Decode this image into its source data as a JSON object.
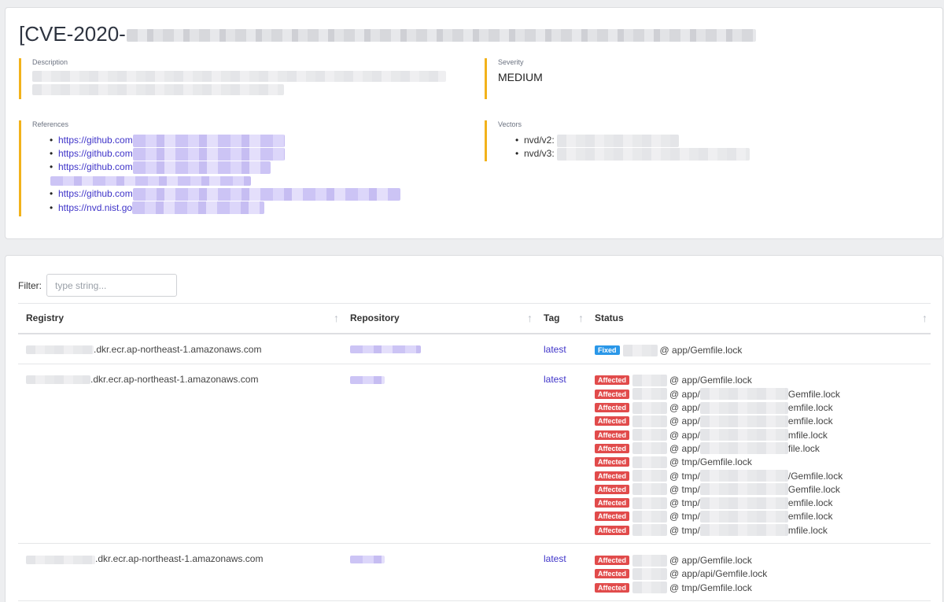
{
  "cve": {
    "title_prefix": "[CVE-2020-"
  },
  "description": {
    "label": "Description"
  },
  "severity": {
    "label": "Severity",
    "value": "MEDIUM"
  },
  "references": {
    "label": "References",
    "items": [
      "https://github.com",
      "https://github.com",
      "https://github.com",
      "https://github.com",
      "https://nvd.nist.go"
    ]
  },
  "vectors": {
    "label": "Vectors",
    "items": [
      "nvd/v2:",
      "nvd/v3:"
    ]
  },
  "filter": {
    "label": "Filter:",
    "placeholder": "type string..."
  },
  "table": {
    "columns": [
      "Registry",
      "Repository",
      "Tag",
      "Status"
    ],
    "sort_icon": "arrow-up-icon",
    "rows": [
      {
        "registry": ".dkr.ecr.ap-northeast-1.amazonaws.com",
        "tag": "latest",
        "statuses": [
          {
            "badge": "Fixed",
            "kind": "fixed",
            "text": "@ app/Gemfile.lock"
          }
        ]
      },
      {
        "registry": ".dkr.ecr.ap-northeast-1.amazonaws.com",
        "tag": "latest",
        "statuses": [
          {
            "badge": "Affected",
            "kind": "affected",
            "text": "@ app/Gemfile.lock"
          },
          {
            "badge": "Affected",
            "kind": "affected",
            "text": "@ app/",
            "tail": "Gemfile.lock"
          },
          {
            "badge": "Affected",
            "kind": "affected",
            "text": "@ app/",
            "tail": "emfile.lock"
          },
          {
            "badge": "Affected",
            "kind": "affected",
            "text": "@ app/",
            "tail": "emfile.lock"
          },
          {
            "badge": "Affected",
            "kind": "affected",
            "text": "@ app/",
            "tail": "mfile.lock"
          },
          {
            "badge": "Affected",
            "kind": "affected",
            "text": "@ app/",
            "tail": "file.lock"
          },
          {
            "badge": "Affected",
            "kind": "affected",
            "text": "@ tmp/Gemfile.lock"
          },
          {
            "badge": "Affected",
            "kind": "affected",
            "text": "@ tmp/",
            "tail": "/Gemfile.lock"
          },
          {
            "badge": "Affected",
            "kind": "affected",
            "text": "@ tmp/",
            "tail": "Gemfile.lock"
          },
          {
            "badge": "Affected",
            "kind": "affected",
            "text": "@ tmp/",
            "tail": "emfile.lock"
          },
          {
            "badge": "Affected",
            "kind": "affected",
            "text": "@ tmp/",
            "tail": "emfile.lock"
          },
          {
            "badge": "Affected",
            "kind": "affected",
            "text": "@ tmp/",
            "tail": "mfile.lock"
          }
        ]
      },
      {
        "registry": ".dkr.ecr.ap-northeast-1.amazonaws.com",
        "tag": "latest",
        "statuses": [
          {
            "badge": "Affected",
            "kind": "affected",
            "text": "@ app/Gemfile.lock"
          },
          {
            "badge": "Affected",
            "kind": "affected",
            "text": "@ app/api/Gemfile.lock"
          },
          {
            "badge": "Affected",
            "kind": "affected",
            "text": "@ tmp/Gemfile.lock"
          }
        ]
      }
    ]
  }
}
